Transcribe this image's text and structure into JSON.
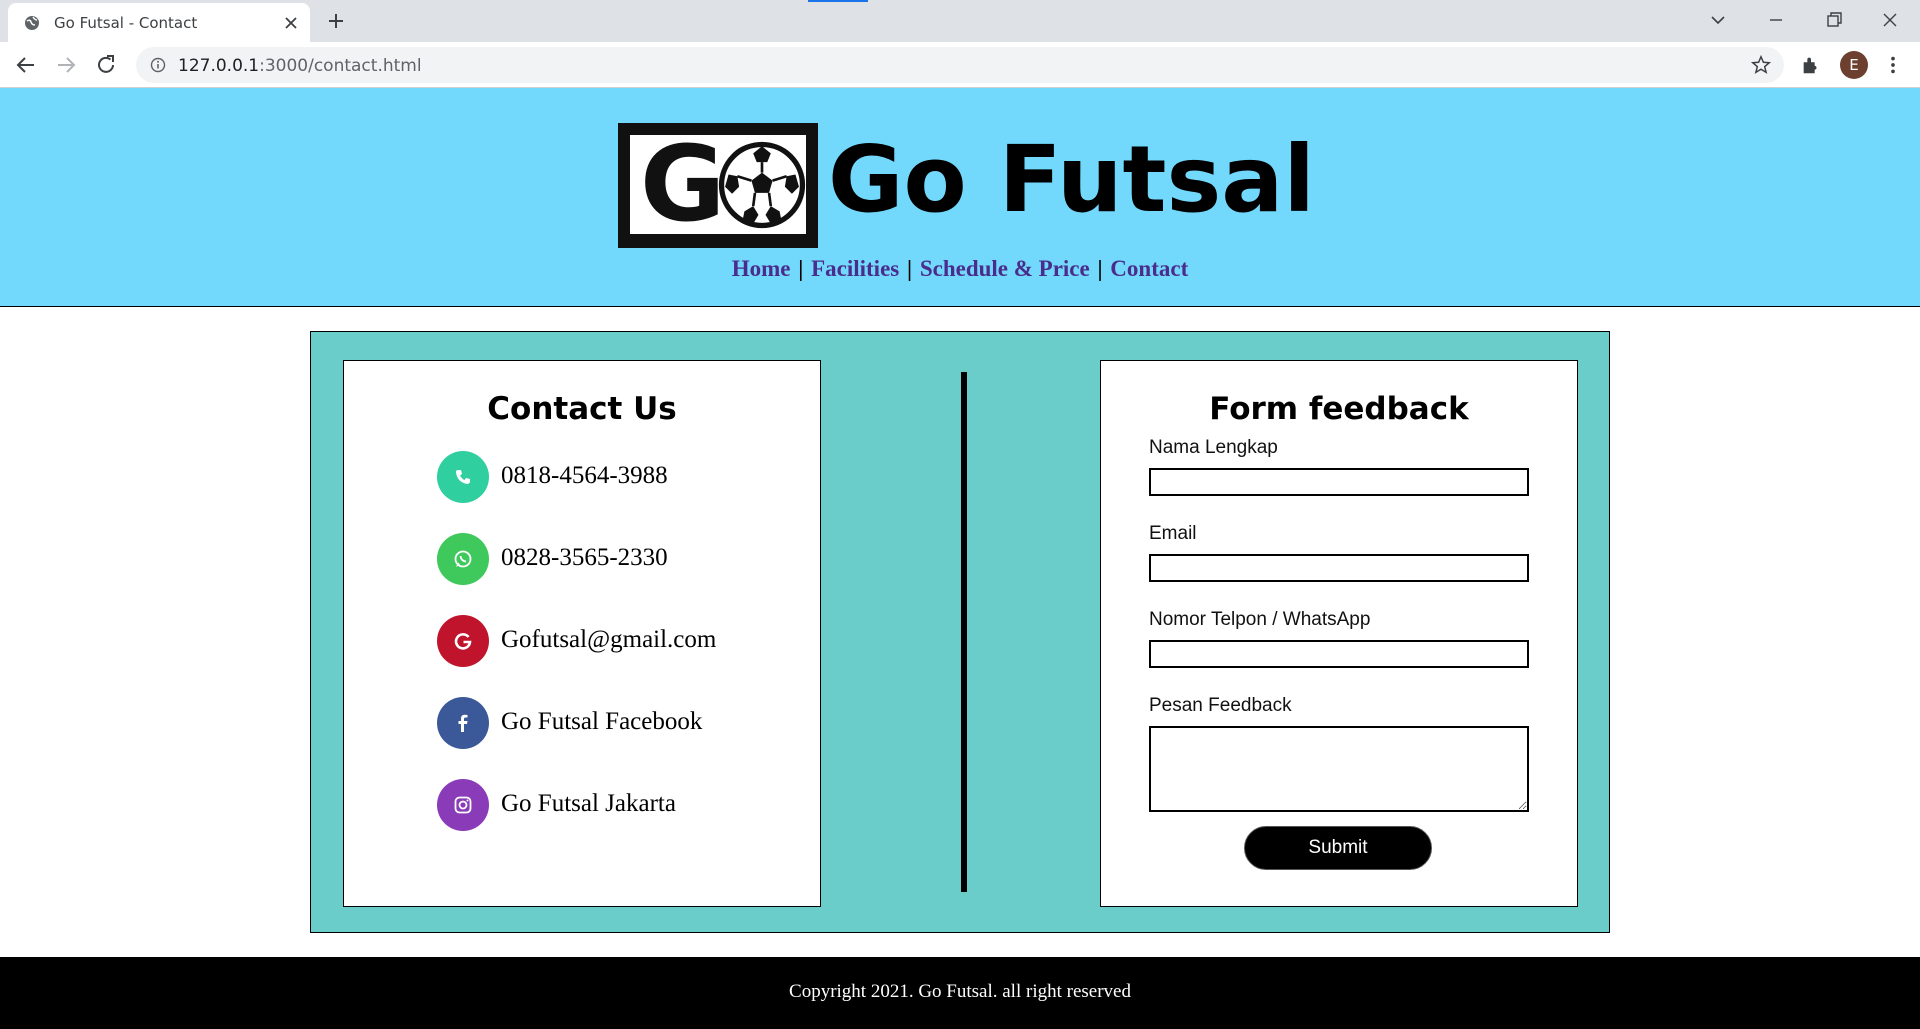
{
  "browser": {
    "tab_title": "Go Futsal - Contact",
    "url_host": "127.0.0.1",
    "url_path": ":3000/contact.html",
    "profile_initial": "E"
  },
  "header": {
    "logo_text": "GO",
    "site_title": "Go Futsal",
    "nav": [
      {
        "label": "Home"
      },
      {
        "label": "Facilities"
      },
      {
        "label": "Schedule & Price"
      },
      {
        "label": "Contact"
      }
    ],
    "nav_separator": "|",
    "background_color": "#72d9fd"
  },
  "contact": {
    "title": "Contact Us",
    "items": [
      {
        "icon": "phone-icon",
        "text": "0818-4564-3988",
        "color": "#2fcf9f"
      },
      {
        "icon": "whatsapp-icon",
        "text": "0828-3565-2330",
        "color": "#3fc95c"
      },
      {
        "icon": "google-icon",
        "text": "Gofutsal@gmail.com",
        "color": "#c0142c"
      },
      {
        "icon": "facebook-icon",
        "text": "Go Futsal Facebook",
        "color": "#3b5998"
      },
      {
        "icon": "instagram-icon",
        "text": "Go Futsal Jakarta",
        "color": "#8a3bb8"
      }
    ]
  },
  "feedback_form": {
    "title": "Form feedback",
    "fields": [
      {
        "label": "Nama Lengkap",
        "value": ""
      },
      {
        "label": "Email",
        "value": ""
      },
      {
        "label": "Nomor Telpon / WhatsApp",
        "value": ""
      },
      {
        "label": "Pesan Feedback",
        "value": ""
      }
    ],
    "submit_label": "Submit"
  },
  "panel_color": "#6bcdc9",
  "footer": {
    "text": "Copyright 2021. Go Futsal. all right reserved"
  }
}
